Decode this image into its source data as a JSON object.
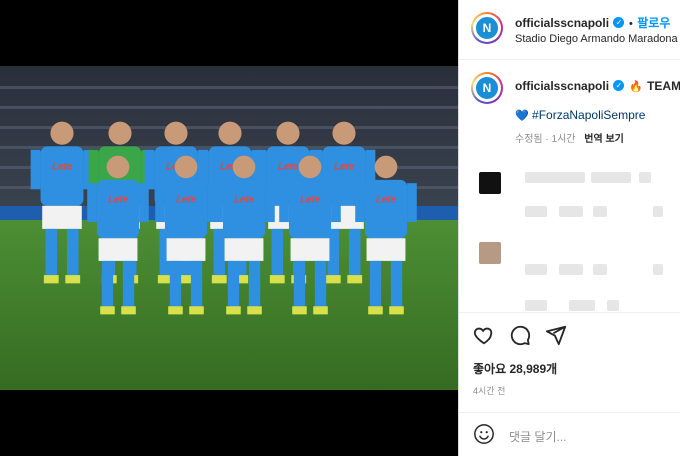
{
  "header": {
    "username": "officialsscnapoli",
    "separator": "•",
    "follow_label": "팔로우",
    "location": "Stadio Diego Armando Maradona",
    "avatar_text": "N"
  },
  "caption": {
    "username": "officialsscnapoli",
    "fire": "🔥",
    "team_text": "TEAM",
    "heart": "💙",
    "hashtag": "#ForzaNapoliSempre",
    "edited_label": "수정됨",
    "edited_time": "1시간",
    "translate_label": "번역 보기"
  },
  "post": {
    "likes_label": "좋아요 28,989개",
    "time_ago": "4시간 전"
  },
  "comment": {
    "placeholder": "댓글 달기..."
  },
  "photo": {
    "shirt_text": "Lete"
  },
  "colors": {
    "shirt": "#2f8fe0",
    "pitch": "#3f7d2a",
    "link": "#0095f6"
  }
}
